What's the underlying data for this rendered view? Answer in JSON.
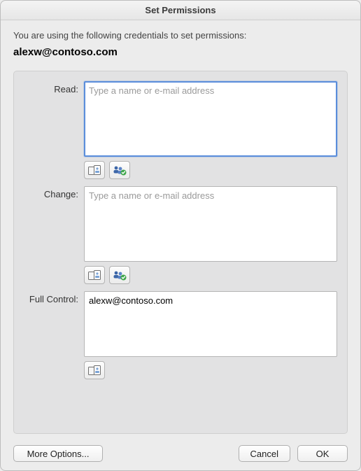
{
  "title": "Set Permissions",
  "intro": "You are using the following credentials to set permissions:",
  "credential": "alexw@contoso.com",
  "fields": {
    "read": {
      "label": "Read:",
      "placeholder": "Type a name or e-mail address",
      "value": ""
    },
    "change": {
      "label": "Change:",
      "placeholder": "Type a name or e-mail address",
      "value": ""
    },
    "full_control": {
      "label": "Full Control:",
      "placeholder": "",
      "value": "alexw@contoso.com"
    }
  },
  "icons": {
    "address_book": "address-book-icon",
    "check_names": "check-names-icon"
  },
  "buttons": {
    "more_options": "More Options...",
    "cancel": "Cancel",
    "ok": "OK"
  }
}
